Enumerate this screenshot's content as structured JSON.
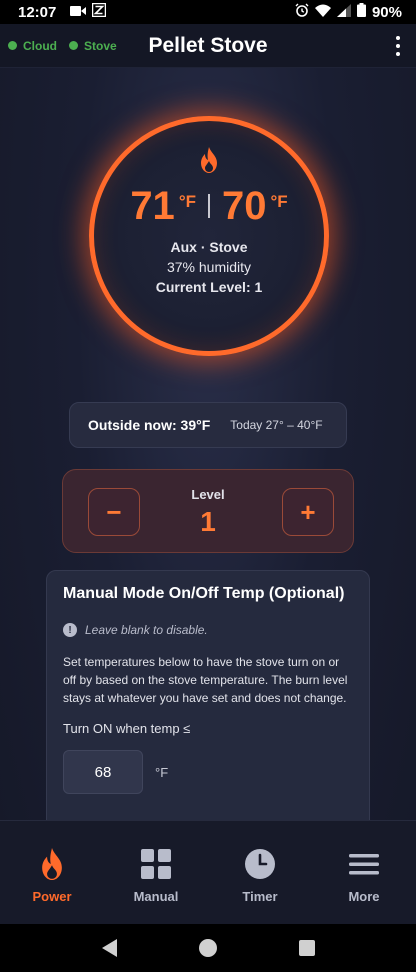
{
  "status_bar": {
    "time": "12:07",
    "battery": "90%",
    "icons": [
      "video-icon",
      "z-notification-icon",
      "alarm-icon",
      "wifi-icon",
      "signal-icon",
      "battery-icon"
    ]
  },
  "header": {
    "title": "Pellet Stove",
    "cloud_label": "Cloud",
    "stove_label": "Stove",
    "status_color": "#4caf50"
  },
  "dial": {
    "icon": "flame-icon",
    "current_temp": "71",
    "set_temp": "70",
    "unit": "°F",
    "mode": "Aux · Stove",
    "humidity": "37% humidity",
    "level": "Current Level: 1",
    "accent": "#ff6a2b"
  },
  "outside": {
    "now": "Outside now: 39°F",
    "range": "Today 27° – 40°F"
  },
  "level_control": {
    "label": "Level",
    "value": "1",
    "minus": "−",
    "plus": "+"
  },
  "manual_mode": {
    "title": "Manual Mode On/Off Temp (Optional)",
    "hint": "Leave blank to disable.",
    "description": "Set temperatures below to have the stove turn on or off by based on the stove temperature. The burn level stays at whatever you have set and does not change.",
    "on_label": "Turn ON when temp ≤",
    "on_value": "68",
    "unit": "°F"
  },
  "nav": {
    "items": [
      {
        "label": "Power",
        "icon": "flame-icon",
        "active": true
      },
      {
        "label": "Manual",
        "icon": "grid-icon",
        "active": false
      },
      {
        "label": "Timer",
        "icon": "clock-icon",
        "active": false
      },
      {
        "label": "More",
        "icon": "menu-icon",
        "active": false
      }
    ]
  }
}
